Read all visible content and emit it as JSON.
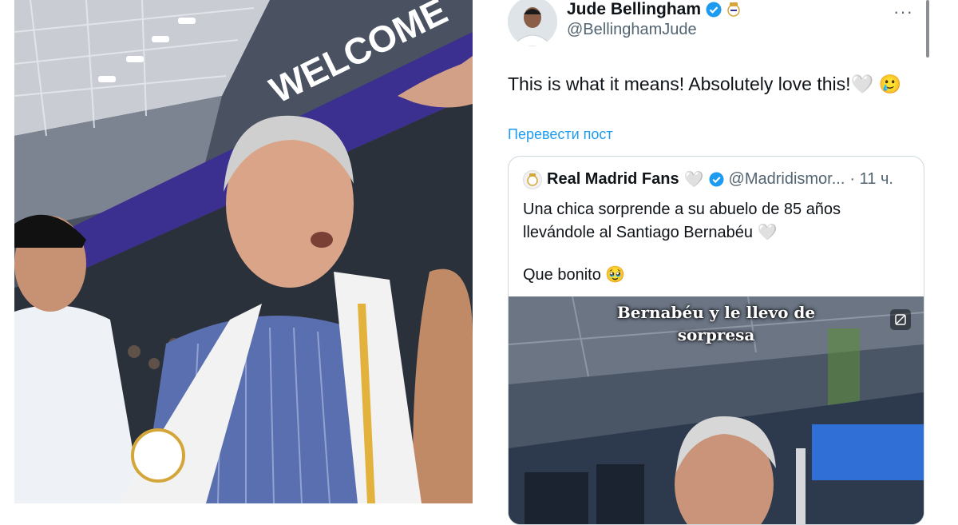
{
  "tweet": {
    "author_name": "Jude Bellingham",
    "author_handle": "@BellinghamJude",
    "more_label": "···",
    "text": "This is what it means! Absolutely love this!🤍 🥲",
    "translate_label": "Перевести пост"
  },
  "quoted": {
    "author_name": "Real Madrid Fans",
    "heart": "🤍",
    "author_handle": "@Madridismor...",
    "time": "· 11 ч.",
    "line1": "Una chica sorprende a su abuelo de 85 años llevándole al Santiago Bernabéu 🤍",
    "line2": "Que bonito 🥹",
    "media_caption_1": "Bernabéu y le llevo de",
    "media_caption_2": "sorpresa"
  },
  "left_photo": {
    "banner_text": "WELCOME"
  },
  "colors": {
    "link": "#1d9bf0",
    "verified": "#1d9bf0",
    "secondary_text": "#536471"
  },
  "icons": [
    "verified-badge-icon",
    "real-madrid-crest-icon",
    "more-icon",
    "media-expand-icon"
  ]
}
